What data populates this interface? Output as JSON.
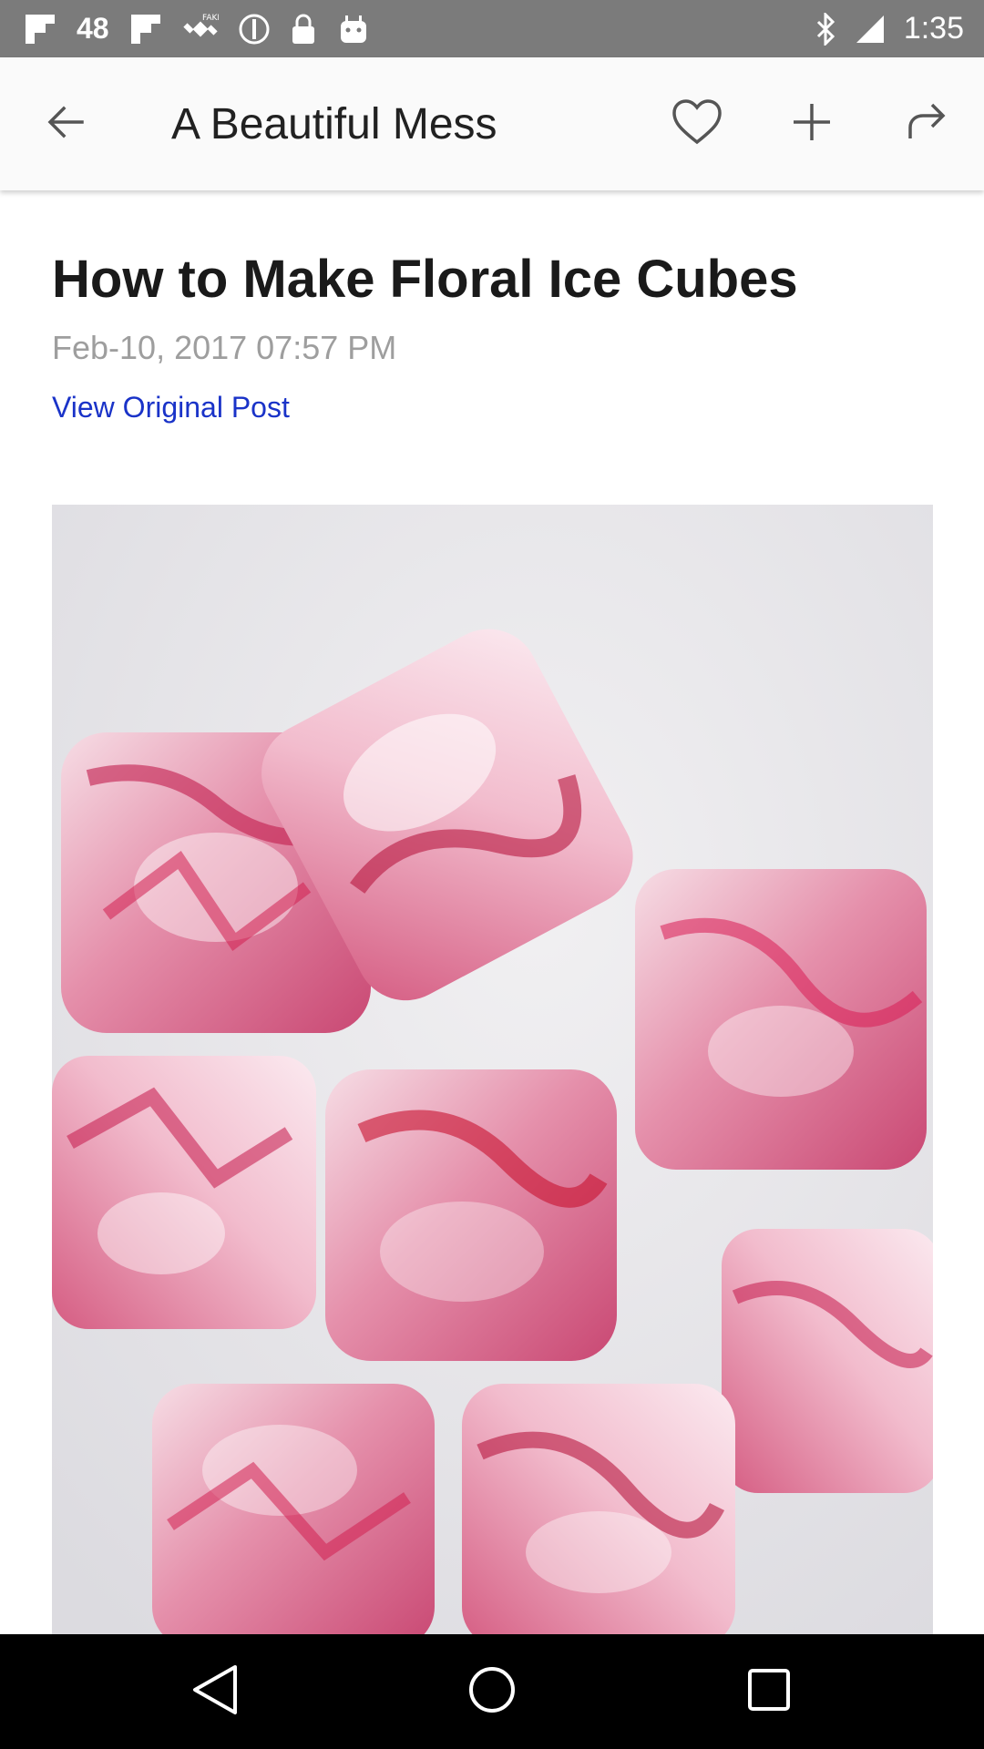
{
  "status_bar": {
    "time": "1:35",
    "notification_count": "48",
    "left_icons": [
      "flipboard-icon",
      "flipboard-icon",
      "fake-gps-icon",
      "do-not-disturb-icon",
      "lock-icon",
      "android-icon"
    ],
    "right_icons": [
      "bluetooth-icon",
      "signal-icon"
    ]
  },
  "app_bar": {
    "title": "A Beautiful Mess",
    "back_icon": "arrow-back-icon",
    "actions": [
      "heart-icon",
      "plus-icon",
      "share-icon"
    ]
  },
  "article": {
    "title": "How to Make Floral Ice Cubes",
    "date": "Feb-10, 2017 07:57 PM",
    "link_label": "View Original Post",
    "image_subject": "floral ice cubes"
  },
  "nav_bar": {
    "buttons": [
      "back-triangle-icon",
      "home-circle-icon",
      "recents-square-icon"
    ]
  },
  "colors": {
    "status_bar": "#7b7b7b",
    "app_bar": "#fafafa",
    "link": "#1a33c8",
    "date": "#9e9e9e",
    "nav_bar": "#000000"
  }
}
